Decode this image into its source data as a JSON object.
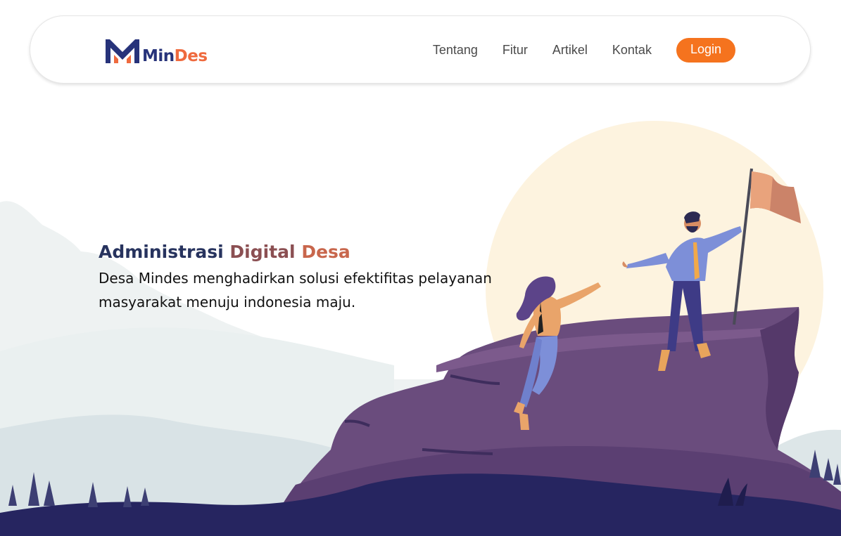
{
  "brand": {
    "name_part1": "Min",
    "name_part2": "Des",
    "colors": {
      "primary": "#27337a",
      "accent": "#ef6a3e"
    }
  },
  "nav": {
    "items": [
      {
        "label": "Tentang"
      },
      {
        "label": "Fitur"
      },
      {
        "label": "Artikel"
      },
      {
        "label": "Kontak"
      }
    ],
    "login_label": "Login",
    "login_color": "#f5731e"
  },
  "hero": {
    "title_part1": "Administrasi ",
    "title_part2": "Digital ",
    "title_part3": "Desa",
    "subtitle": "Desa Mindes menghadirkan solusi efektifitas pelayanan masyarakat menuju indonesia maju."
  },
  "illustration": {
    "sun_color": "#fdf3df",
    "rock_color": "#6a4c7d",
    "ground_color": "#262560"
  }
}
